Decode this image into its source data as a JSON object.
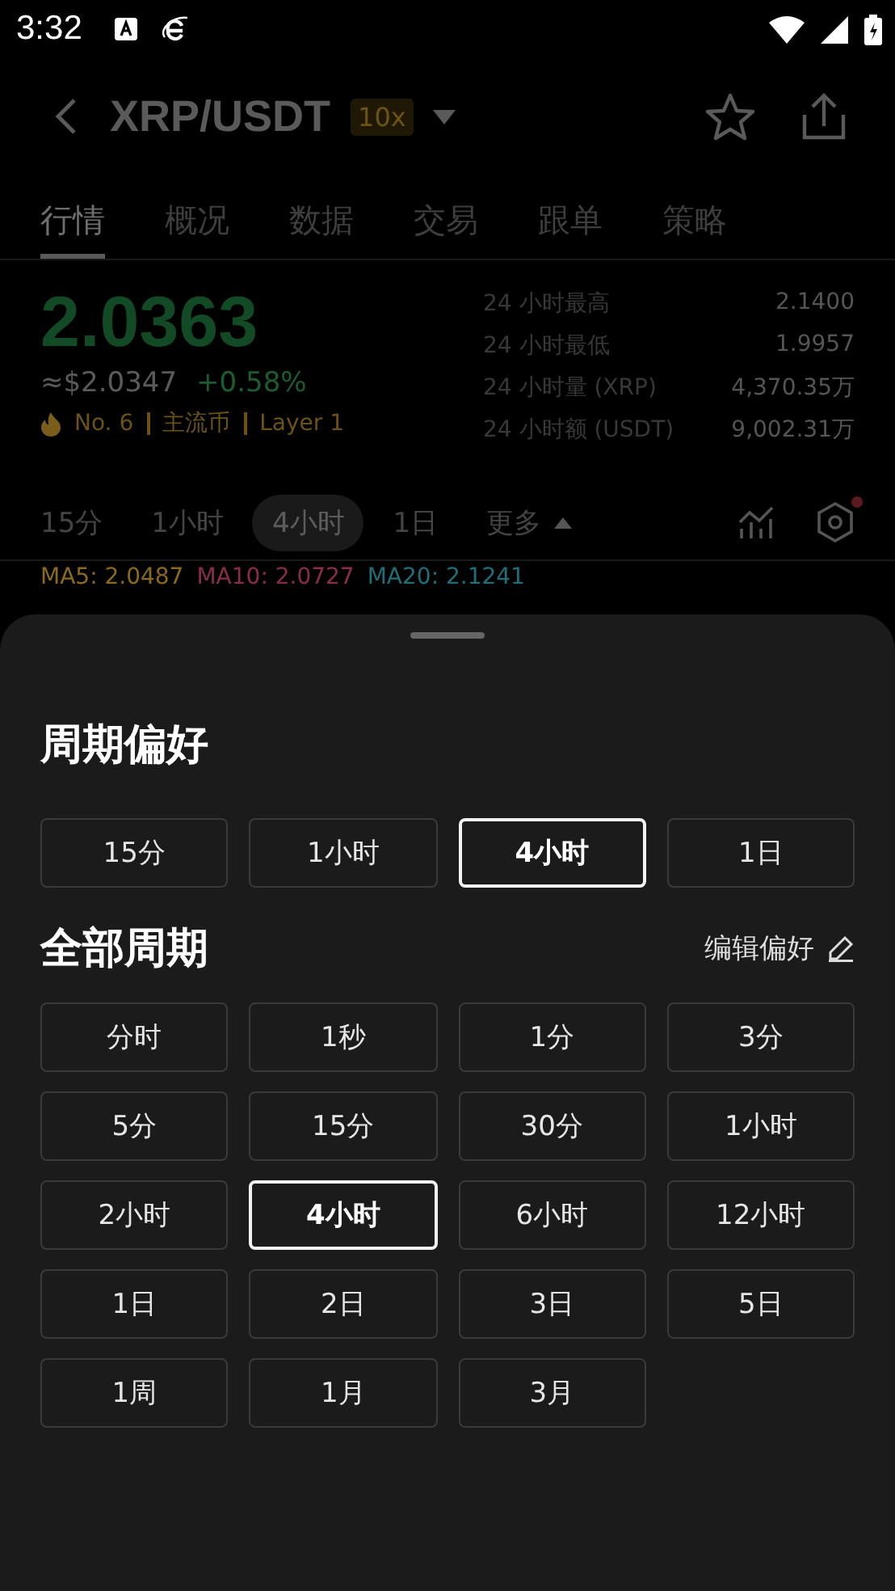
{
  "status_bar": {
    "time": "3:32"
  },
  "header": {
    "title": "XRP/USDT",
    "leverage": "10x"
  },
  "tabs": [
    {
      "label": "行情",
      "selected": true
    },
    {
      "label": "概况",
      "selected": false
    },
    {
      "label": "数据",
      "selected": false
    },
    {
      "label": "交易",
      "selected": false
    },
    {
      "label": "跟单",
      "selected": false
    },
    {
      "label": "策略",
      "selected": false
    }
  ],
  "price": {
    "last": "2.0363",
    "usd": "≈$2.0347",
    "change": "+0.58%",
    "rank": "No. 6",
    "tags": [
      "主流币",
      "Layer 1"
    ]
  },
  "stats": [
    {
      "label": "24 小时最高",
      "value": "2.1400"
    },
    {
      "label": "24 小时最低",
      "value": "1.9957"
    },
    {
      "label": "24 小时量 (XRP)",
      "value": "4,370.35万"
    },
    {
      "label": "24 小时额 (USDT)",
      "value": "9,002.31万"
    }
  ],
  "intervals": [
    {
      "label": "15分",
      "selected": false
    },
    {
      "label": "1小时",
      "selected": false
    },
    {
      "label": "4小时",
      "selected": true
    },
    {
      "label": "1日",
      "selected": false
    }
  ],
  "more": "更多",
  "indicators": [
    {
      "label": "MA5: 2.0487",
      "color": "#8a6a1e"
    },
    {
      "label": "MA10: 2.0727",
      "color": "#8a2e48"
    },
    {
      "label": "MA20: 2.1241",
      "color": "#1f6f78"
    }
  ],
  "sheet": {
    "title": "周期偏好",
    "preferred": [
      {
        "label": "15分",
        "selected": false
      },
      {
        "label": "1小时",
        "selected": false
      },
      {
        "label": "4小时",
        "selected": true
      },
      {
        "label": "1日",
        "selected": false
      }
    ],
    "all_title": "全部周期",
    "edit": "编辑偏好",
    "all": [
      {
        "label": "分时",
        "selected": false
      },
      {
        "label": "1秒",
        "selected": false
      },
      {
        "label": "1分",
        "selected": false
      },
      {
        "label": "3分",
        "selected": false
      },
      {
        "label": "5分",
        "selected": false
      },
      {
        "label": "15分",
        "selected": false
      },
      {
        "label": "30分",
        "selected": false
      },
      {
        "label": "1小时",
        "selected": false
      },
      {
        "label": "2小时",
        "selected": false
      },
      {
        "label": "4小时",
        "selected": true
      },
      {
        "label": "6小时",
        "selected": false
      },
      {
        "label": "12小时",
        "selected": false
      },
      {
        "label": "1日",
        "selected": false
      },
      {
        "label": "2日",
        "selected": false
      },
      {
        "label": "3日",
        "selected": false
      },
      {
        "label": "5日",
        "selected": false
      },
      {
        "label": "1周",
        "selected": false
      },
      {
        "label": "1月",
        "selected": false
      },
      {
        "label": "3月",
        "selected": false
      }
    ]
  }
}
